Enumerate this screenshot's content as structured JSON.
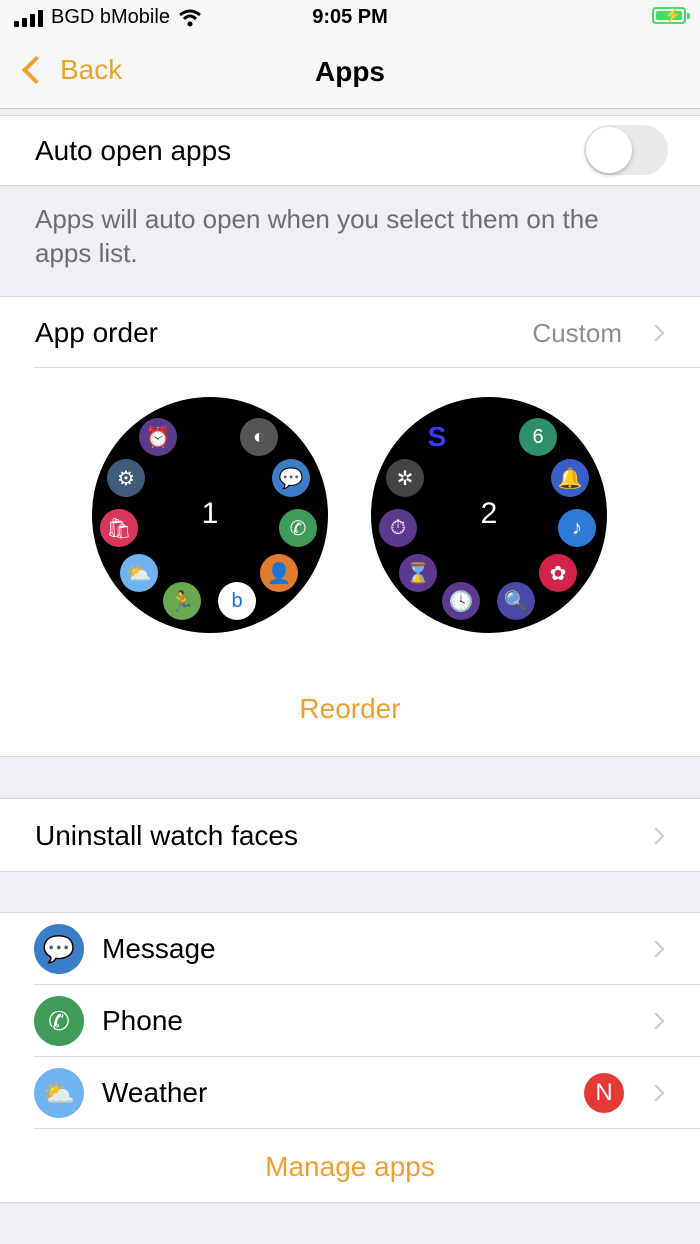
{
  "status_bar": {
    "carrier": "BGD bMobile",
    "time": "9:05 PM"
  },
  "nav": {
    "back_label": "Back",
    "title": "Apps"
  },
  "auto_open": {
    "label": "Auto open apps",
    "enabled": false,
    "footnote": "Apps will auto open when you select them on the apps list."
  },
  "app_order": {
    "label": "App order",
    "value": "Custom",
    "watch_pages": [
      "1",
      "2"
    ],
    "reorder_label": "Reorder"
  },
  "uninstall": {
    "label": "Uninstall watch faces"
  },
  "apps": [
    {
      "name": "Message",
      "icon": "message-icon",
      "color": "#3a7ec8"
    },
    {
      "name": "Phone",
      "icon": "phone-icon",
      "color": "#3e9b58"
    },
    {
      "name": "Weather",
      "icon": "weather-icon",
      "color": "#6fb4f0",
      "badge": "N"
    }
  ],
  "manage_label": "Manage apps",
  "colors": {
    "accent": "#f0a030",
    "badge": "#e53935"
  }
}
